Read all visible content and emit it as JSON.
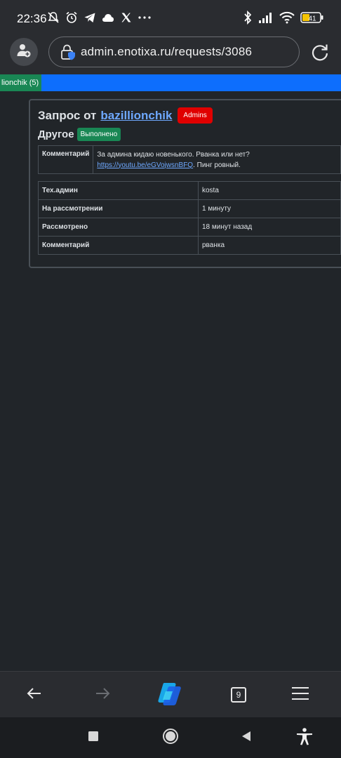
{
  "status_bar": {
    "time": "22:36",
    "left_icons": [
      "do-not-disturb-off-icon",
      "alarm-icon",
      "telegram-icon",
      "cloud-icon",
      "x-icon",
      "more-dots-icon"
    ],
    "right_icons": [
      "bluetooth-icon",
      "signal-icon",
      "wifi-icon",
      "battery-icon"
    ],
    "battery_level": "41"
  },
  "browser": {
    "url": "admin.enotixa.ru/requests/3086",
    "tab_count": "9"
  },
  "nav": {
    "user_tab": "lionchik (5)"
  },
  "request": {
    "title_prefix": "Запрос от",
    "user_link": "bazillionchik",
    "group_badge": "Admins",
    "category": "Другое",
    "status_badge": "Выполнено",
    "comment_label": "Комментарий",
    "comment_text_before": "За админа кидаю новенького. Рванка или нет?",
    "comment_link": "https://youtu.be/eGVojwsnBFQ",
    "comment_text_after": ". Пинг ровный."
  },
  "review": {
    "rows": [
      {
        "label": "Тех.админ",
        "value": "kosta"
      },
      {
        "label": "На рассмотрении",
        "value": "1 минуту"
      },
      {
        "label": "Рассмотрено",
        "value": "18 минут назад"
      },
      {
        "label": "Комментарий",
        "value": "рванка"
      }
    ]
  },
  "colors": {
    "background": "#212529",
    "nav_blue": "#0d6efd",
    "success_green": "#198754",
    "danger_red": "#e00000",
    "link_blue": "#6ea8fe"
  }
}
